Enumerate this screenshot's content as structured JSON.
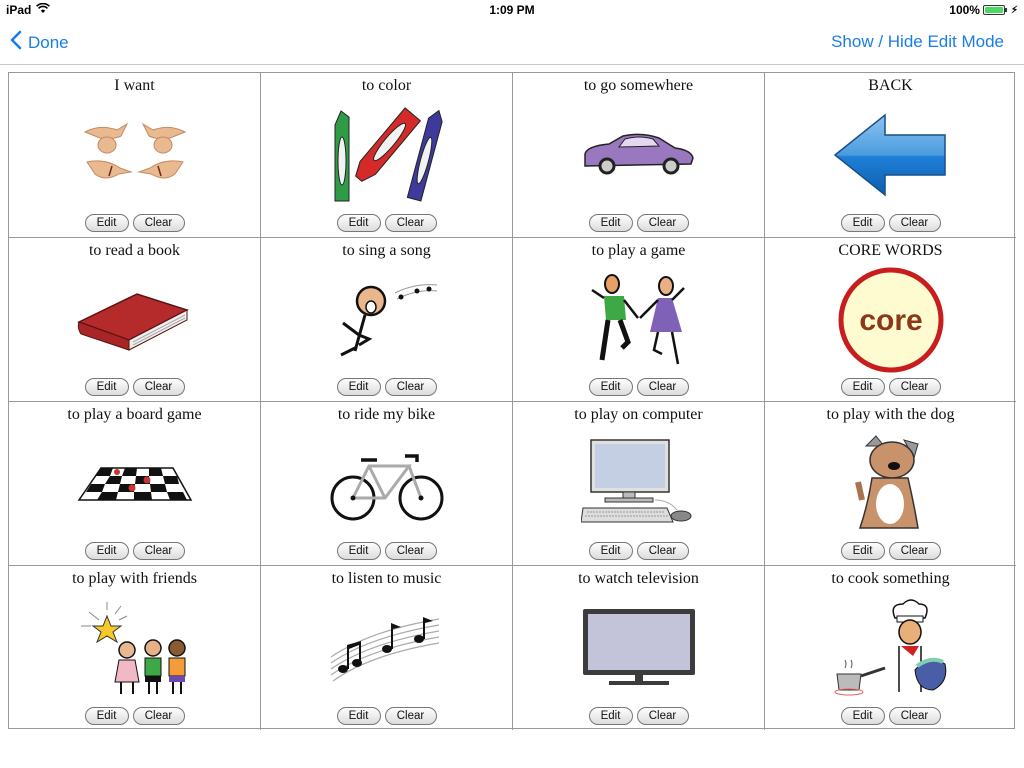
{
  "status_bar": {
    "device": "iPad",
    "time": "1:09 PM",
    "battery": "100%",
    "battery_level": 1.0
  },
  "nav": {
    "back_label": "Done",
    "right_label": "Show / Hide Edit Mode"
  },
  "buttons": {
    "edit": "Edit",
    "clear": "Clear"
  },
  "cells": [
    {
      "label": "I want",
      "icon": "sign-language-hands"
    },
    {
      "label": "to color",
      "icon": "crayons"
    },
    {
      "label": "to go somewhere",
      "icon": "car"
    },
    {
      "label": "BACK",
      "icon": "back-arrow"
    },
    {
      "label": "to read a book",
      "icon": "book"
    },
    {
      "label": "to sing a song",
      "icon": "singer"
    },
    {
      "label": "to play a game",
      "icon": "kids-playing"
    },
    {
      "label": "CORE WORDS",
      "icon": "core-badge",
      "badge_text": "core"
    },
    {
      "label": "to play a board game",
      "icon": "checkerboard"
    },
    {
      "label": "to ride my bike",
      "icon": "bicycle"
    },
    {
      "label": "to play on computer",
      "icon": "computer"
    },
    {
      "label": "to play with the dog",
      "icon": "dog"
    },
    {
      "label": "to play with friends",
      "icon": "friends"
    },
    {
      "label": "to listen to music",
      "icon": "music-notes"
    },
    {
      "label": "to watch television",
      "icon": "television"
    },
    {
      "label": "to cook something",
      "icon": "chef"
    }
  ]
}
